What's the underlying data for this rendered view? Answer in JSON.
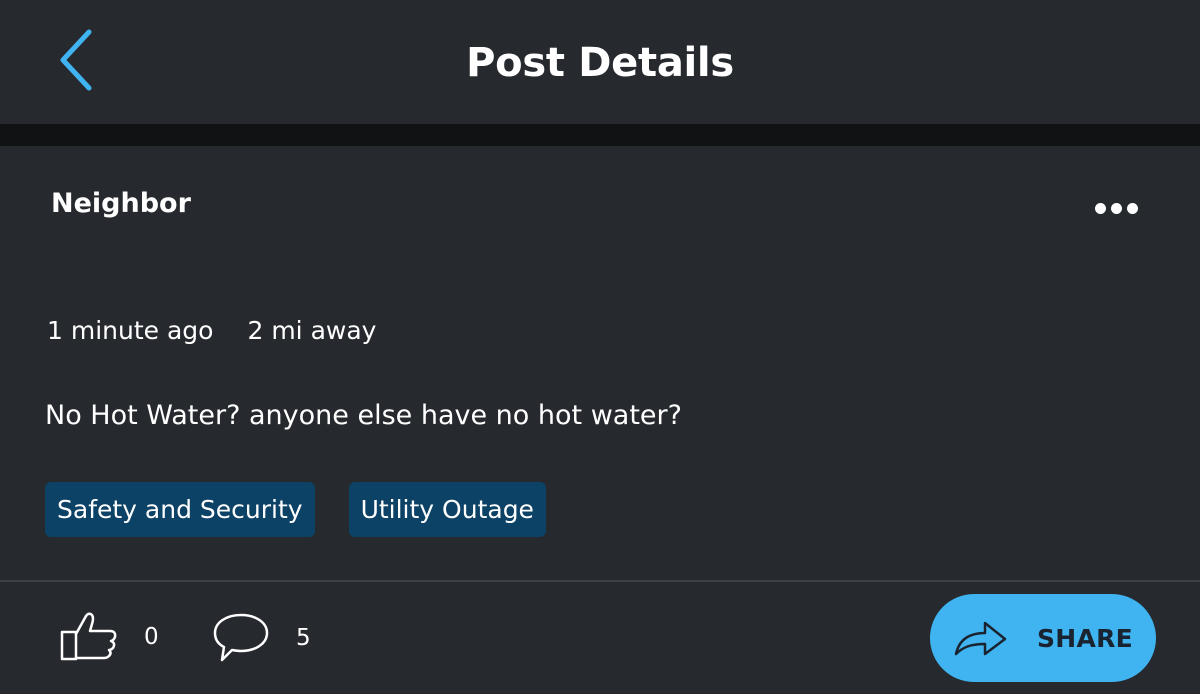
{
  "header": {
    "title": "Post Details",
    "back_icon": "chevron-left-icon"
  },
  "post": {
    "author": "Neighbor",
    "more_icon": "more-horizontal-icon",
    "time_ago": "1 minute ago",
    "distance": "2 mi away",
    "text": "No Hot Water? anyone else have no hot water?",
    "tags": [
      {
        "label": "Safety and Security"
      },
      {
        "label": "Utility Outage"
      }
    ]
  },
  "footer": {
    "like_icon": "thumbs-up-icon",
    "like_count": "0",
    "comment_icon": "comment-bubble-icon",
    "comment_count": "5",
    "share_icon": "share-arrow-icon",
    "share_label": "SHARE"
  },
  "colors": {
    "background": "#26292e",
    "separator": "#111213",
    "accent": "#3fb4f1",
    "tag_background": "#0c4266"
  }
}
